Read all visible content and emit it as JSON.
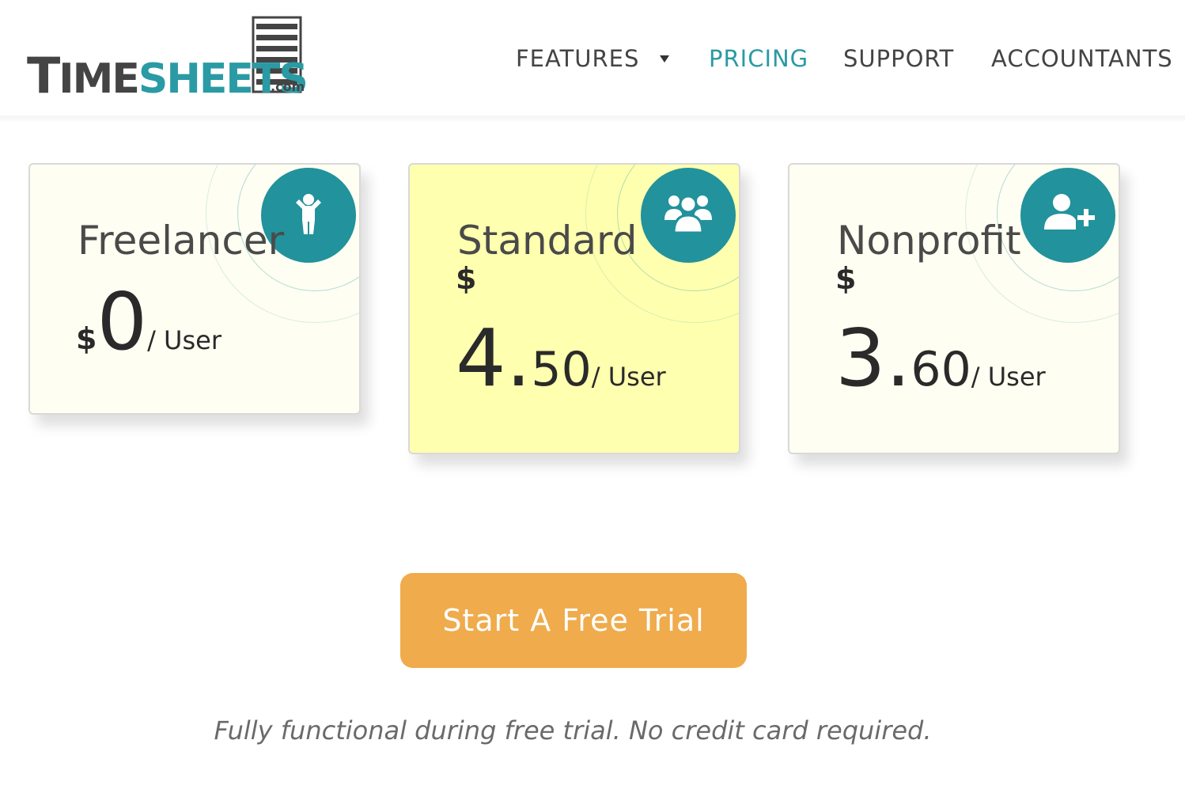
{
  "brand": {
    "logo_main": "TIMESHEETS",
    "logo_suffix": ".com"
  },
  "nav": {
    "features": "FEATURES",
    "pricing": "PRICING",
    "support": "SUPPORT",
    "accountants": "ACCOUNTANTS"
  },
  "plans": [
    {
      "name": "Freelancer",
      "currency": "$",
      "price_whole": "0",
      "price_cents": "",
      "per": "/ User",
      "icon": "person-icon",
      "highlighted": false
    },
    {
      "name": "Standard",
      "currency": "$",
      "price_whole": "4.",
      "price_cents": "50",
      "per": "/ User",
      "icon": "group-icon",
      "highlighted": true
    },
    {
      "name": "Nonprofit",
      "currency": "$",
      "price_whole": "3.",
      "price_cents": "60",
      "per": "/ User",
      "icon": "add-user-icon",
      "highlighted": false
    }
  ],
  "cta": {
    "label": "Start A Free Trial"
  },
  "note": "Fully functional during free trial. No credit card required.",
  "colors": {
    "accent": "#2a9aa4",
    "cta": "#efab4c",
    "highlight_card": "#ffffb0",
    "card": "#fefef2"
  }
}
